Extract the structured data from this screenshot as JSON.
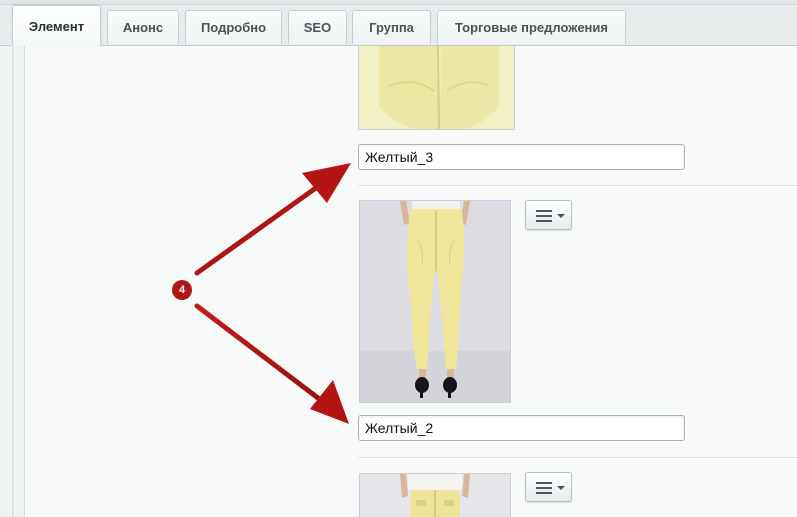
{
  "tabs": [
    {
      "label": "Элемент",
      "active": true
    },
    {
      "label": "Анонс"
    },
    {
      "label": "Подробно"
    },
    {
      "label": "SEO"
    },
    {
      "label": "Группа"
    },
    {
      "label": "Торговые предложения"
    }
  ],
  "images": [
    {
      "name": "Желтый_3",
      "alt_icon": "yellow-pants-photo"
    },
    {
      "name": "Желтый_2",
      "alt_icon": "yellow-pants-photo",
      "menu_icon": "hamburger-menu-icon"
    },
    {
      "alt_icon": "yellow-pants-photo",
      "menu_icon": "hamburger-menu-icon"
    }
  ],
  "annotation": {
    "number": "4",
    "color": "#b11616"
  }
}
